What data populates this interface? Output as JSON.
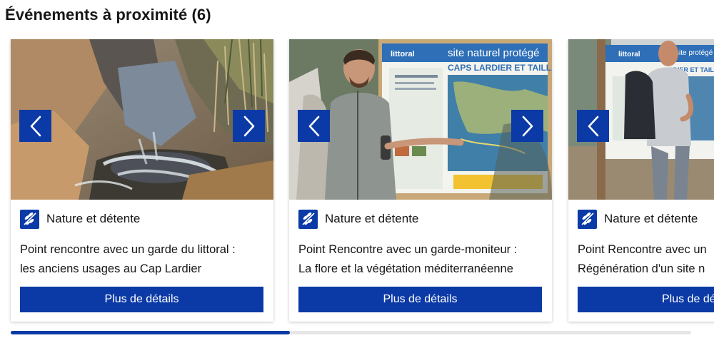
{
  "section": {
    "title": "Événements à proximité (6)"
  },
  "colors": {
    "accent": "#0b3aa6",
    "text": "#161616",
    "track": "#e6e6e6"
  },
  "cards": [
    {
      "category": "Nature et détente",
      "title_line1": "Point rencontre avec un garde du littoral :",
      "title_line2": "les anciens usages au Cap Lardier",
      "button": "Plus de détails",
      "image": "rocky-stream-photo"
    },
    {
      "category": "Nature et détente",
      "title_line1": "Point Rencontre avec un garde-moniteur :",
      "title_line2": "La flore et la végétation méditerranéenne",
      "button": "Plus de détails",
      "image": "guide-at-sign-photo",
      "sign": {
        "brand": "littoral",
        "headline": "site naturel protégé",
        "subhead": "CAPS LARDIER ET TAILLAT"
      }
    },
    {
      "category": "Nature et détente",
      "title_line1": "Point Rencontre avec un",
      "title_line2": "Régénération d'un site n",
      "button": "Plus de dé",
      "image": "hiker-at-sign-photo",
      "sign": {
        "brand": "littoral",
        "headline": "site protégé",
        "subhead": "RDIER ET TAILLAT"
      }
    }
  ],
  "carousel": {
    "progress_fraction": 0.41
  }
}
